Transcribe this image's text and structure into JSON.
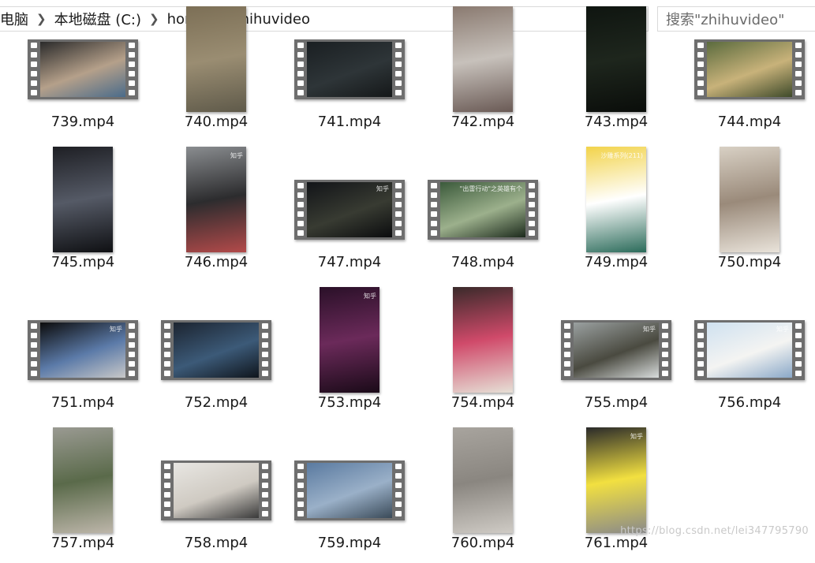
{
  "breadcrumb": {
    "items": [
      "电脑",
      "本地磁盘 (C:)",
      "home",
      "zhihuvideo"
    ]
  },
  "search": {
    "placeholder": "搜索\"zhihuvideo\""
  },
  "files": [
    {
      "name": "739.mp4",
      "kind": "film",
      "colors": [
        "#2b2b2b",
        "#b5a08a",
        "#4a6b8a"
      ],
      "overlay": ""
    },
    {
      "name": "740.mp4",
      "kind": "portrait",
      "colors": [
        "#7c6f56",
        "#9a8d72",
        "#5f5a4a"
      ],
      "overlay": ""
    },
    {
      "name": "741.mp4",
      "kind": "film",
      "colors": [
        "#1a1f22",
        "#2e3538",
        "#151819"
      ],
      "overlay": ""
    },
    {
      "name": "742.mp4",
      "kind": "portrait",
      "colors": [
        "#8a7a70",
        "#c7c1bb",
        "#6a5a55"
      ],
      "overlay": ""
    },
    {
      "name": "743.mp4",
      "kind": "portrait",
      "colors": [
        "#0f1510",
        "#1e261d",
        "#0a0d0a"
      ],
      "overlay": ""
    },
    {
      "name": "744.mp4",
      "kind": "film",
      "colors": [
        "#5b6b3e",
        "#c8b27a",
        "#3e4a2a"
      ],
      "overlay": ""
    },
    {
      "name": "745.mp4",
      "kind": "portrait",
      "colors": [
        "#1e1f24",
        "#555a66",
        "#0f1013"
      ],
      "overlay": ""
    },
    {
      "name": "746.mp4",
      "kind": "portrait",
      "colors": [
        "#8a8d90",
        "#2c2c2e",
        "#b34a4a"
      ],
      "overlay": "知乎"
    },
    {
      "name": "747.mp4",
      "kind": "film",
      "colors": [
        "#121418",
        "#383b32",
        "#0b0c0e"
      ],
      "overlay": "知乎"
    },
    {
      "name": "748.mp4",
      "kind": "film",
      "colors": [
        "#3b5a3b",
        "#9cb08c",
        "#1c2a1c"
      ],
      "overlay": "\"出雷行动\"之英雄有个"
    },
    {
      "name": "749.mp4",
      "kind": "portrait",
      "colors": [
        "#f2d34a",
        "#ffffff",
        "#2b6b5a"
      ],
      "overlay": "沙雕系列(211)"
    },
    {
      "name": "750.mp4",
      "kind": "portrait",
      "colors": [
        "#d8d0c4",
        "#9a8a7a",
        "#e9e3da"
      ],
      "overlay": ""
    },
    {
      "name": "751.mp4",
      "kind": "film",
      "colors": [
        "#0c0c0c",
        "#5b7aa8",
        "#c8c8c8"
      ],
      "overlay": "知乎"
    },
    {
      "name": "752.mp4",
      "kind": "film",
      "colors": [
        "#1c2430",
        "#3c5a78",
        "#0f151c"
      ],
      "overlay": ""
    },
    {
      "name": "753.mp4",
      "kind": "portrait",
      "colors": [
        "#2a1028",
        "#6b2a5a",
        "#1a0a18"
      ],
      "overlay": "知乎"
    },
    {
      "name": "754.mp4",
      "kind": "portrait",
      "colors": [
        "#3a2a2a",
        "#d04a6a",
        "#e6e0d6"
      ],
      "overlay": ""
    },
    {
      "name": "755.mp4",
      "kind": "film",
      "colors": [
        "#9aa0a0",
        "#4a4a40",
        "#d8dcdc"
      ],
      "overlay": "知乎"
    },
    {
      "name": "756.mp4",
      "kind": "film",
      "colors": [
        "#cfe1f0",
        "#f4f4f2",
        "#8aa8c8"
      ],
      "overlay": "知乎"
    },
    {
      "name": "757.mp4",
      "kind": "portrait",
      "colors": [
        "#9a9a92",
        "#5a6a4a",
        "#bdb6aa"
      ],
      "overlay": ""
    },
    {
      "name": "758.mp4",
      "kind": "film",
      "colors": [
        "#e8e6e2",
        "#cfcac2",
        "#3a3a3a"
      ],
      "overlay": ""
    },
    {
      "name": "759.mp4",
      "kind": "film",
      "colors": [
        "#5a7aa0",
        "#9ab0c8",
        "#3a4a58"
      ],
      "overlay": ""
    },
    {
      "name": "760.mp4",
      "kind": "portrait",
      "colors": [
        "#a8a49e",
        "#8a8680",
        "#cfcbc5"
      ],
      "overlay": ""
    },
    {
      "name": "761.mp4",
      "kind": "portrait",
      "colors": [
        "#2a2a2a",
        "#f2e040",
        "#8a8a8a"
      ],
      "overlay": "知乎"
    }
  ],
  "watermark": "https://blog.csdn.net/lei347795790"
}
